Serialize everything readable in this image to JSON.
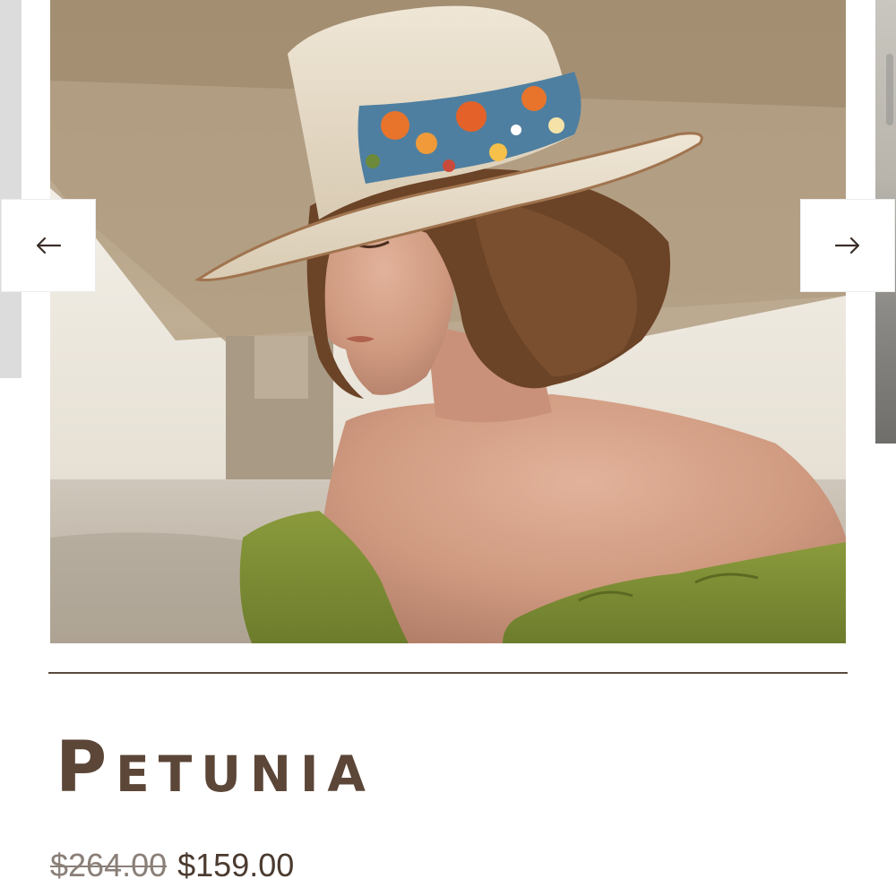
{
  "carousel": {
    "prev_label": "Previous",
    "next_label": "Next",
    "image_alt": "Woman wearing straw hat with embroidered floral band"
  },
  "product": {
    "title": "Petunia",
    "price_original": "$264.00",
    "price_sale": "$159.00"
  },
  "icons": {
    "prev": "arrow-left-icon",
    "next": "arrow-right-icon"
  },
  "colors": {
    "title": "#5b4638",
    "divider": "#5a4a3d",
    "price_old": "#8a7f78",
    "price_new": "#4b3a2f"
  }
}
